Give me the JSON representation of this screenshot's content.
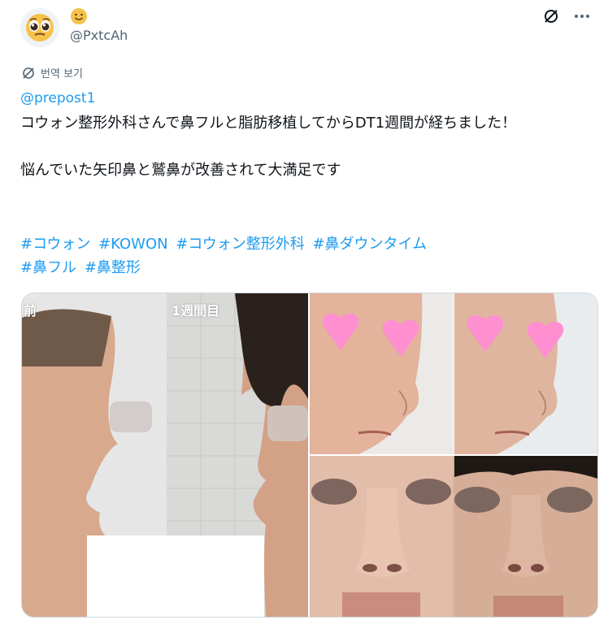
{
  "header": {
    "handle": "@PxtcAh",
    "name_emoji": "slightly-smiling-face"
  },
  "translate": {
    "label": "번역 보기"
  },
  "tweet": {
    "mention": "@prepost1",
    "text": "コウォン整形外科さんで鼻フルと脂肪移植してからDT1週間が経ちました！\n\n悩んでいた矢印鼻と鷲鼻が改善されて大満足です",
    "hashtags": [
      "#コウォン",
      "#KOWON",
      "#コウォン整形外科",
      "#鼻ダウンタイム",
      "#鼻フル",
      "#鼻整形"
    ]
  },
  "media": {
    "left_label_before": "前",
    "left_label_after": "1週間目"
  },
  "colors": {
    "link": "#1d9bf0",
    "muted": "#536471",
    "heart": "#ff8fd0"
  }
}
